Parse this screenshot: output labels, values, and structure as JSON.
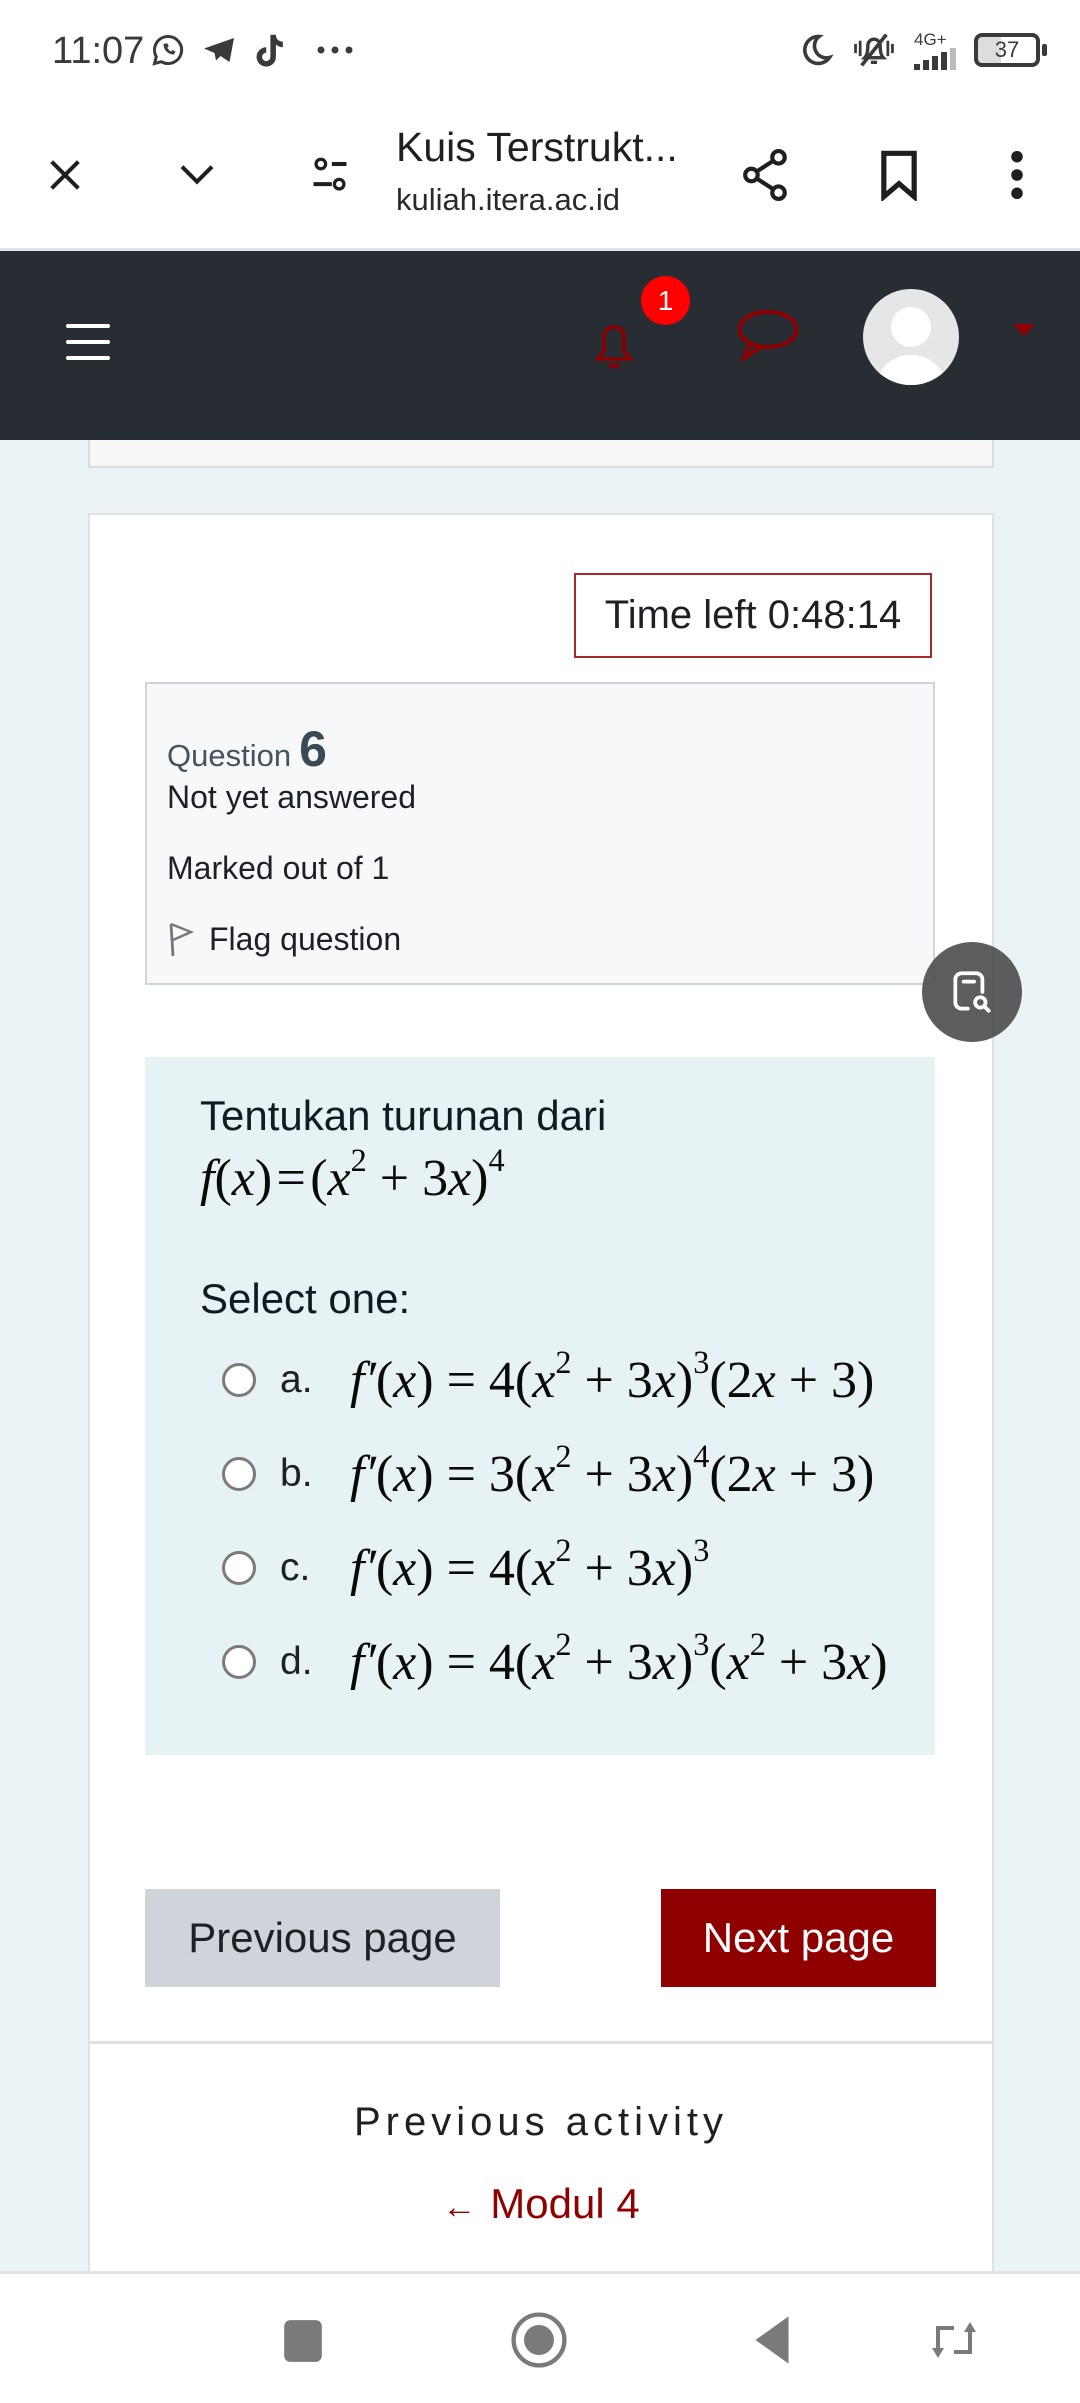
{
  "status_bar": {
    "time": "11:07",
    "notification_icons": [
      "whatsapp-icon",
      "telegram-icon",
      "tiktok-icon",
      "more-dots-icon"
    ],
    "system_icons": [
      "do-not-disturb-moon-icon",
      "vibrate-muted-icon",
      "signal-4g-plus-icon"
    ],
    "network_label": "4G+",
    "battery_level": "37"
  },
  "browser": {
    "page_title": "Kuis Terstrukt...",
    "url": "kuliah.itera.ac.id",
    "buttons": [
      "close",
      "collapse",
      "site-settings",
      "share",
      "bookmark",
      "more"
    ]
  },
  "navbar": {
    "notification_count": "1",
    "accent_color": "#8f0000",
    "badge_color": "#ff0000"
  },
  "quiz": {
    "timer_label": "Time left 0:48:14",
    "question_label": "Question",
    "question_number": "6",
    "state": "Not yet answered",
    "marks": "Marked out of 1",
    "flag_label": "Flag question",
    "prompt": "Tentukan turunan dari",
    "formula": "f(x) = (x² + 3x)⁴",
    "select_label": "Select one:",
    "options": [
      {
        "letter": "a.",
        "text": "f′(x) = 4(x² + 3x)³(2x + 3)",
        "selected": false
      },
      {
        "letter": "b.",
        "text": "f′(x) = 3(x² + 3x)⁴(2x + 3)",
        "selected": false
      },
      {
        "letter": "c.",
        "text": "f′(x) = 4(x² + 3x)³",
        "selected": false
      },
      {
        "letter": "d.",
        "text": "f′(x) = 4(x² + 3x)³(x² + 3x)",
        "selected": false
      }
    ],
    "prev_button": "Previous page",
    "next_button": "Next page"
  },
  "activity_nav": {
    "heading": "Previous activity",
    "link_arrow": "←",
    "link_label": "Modul 4"
  }
}
